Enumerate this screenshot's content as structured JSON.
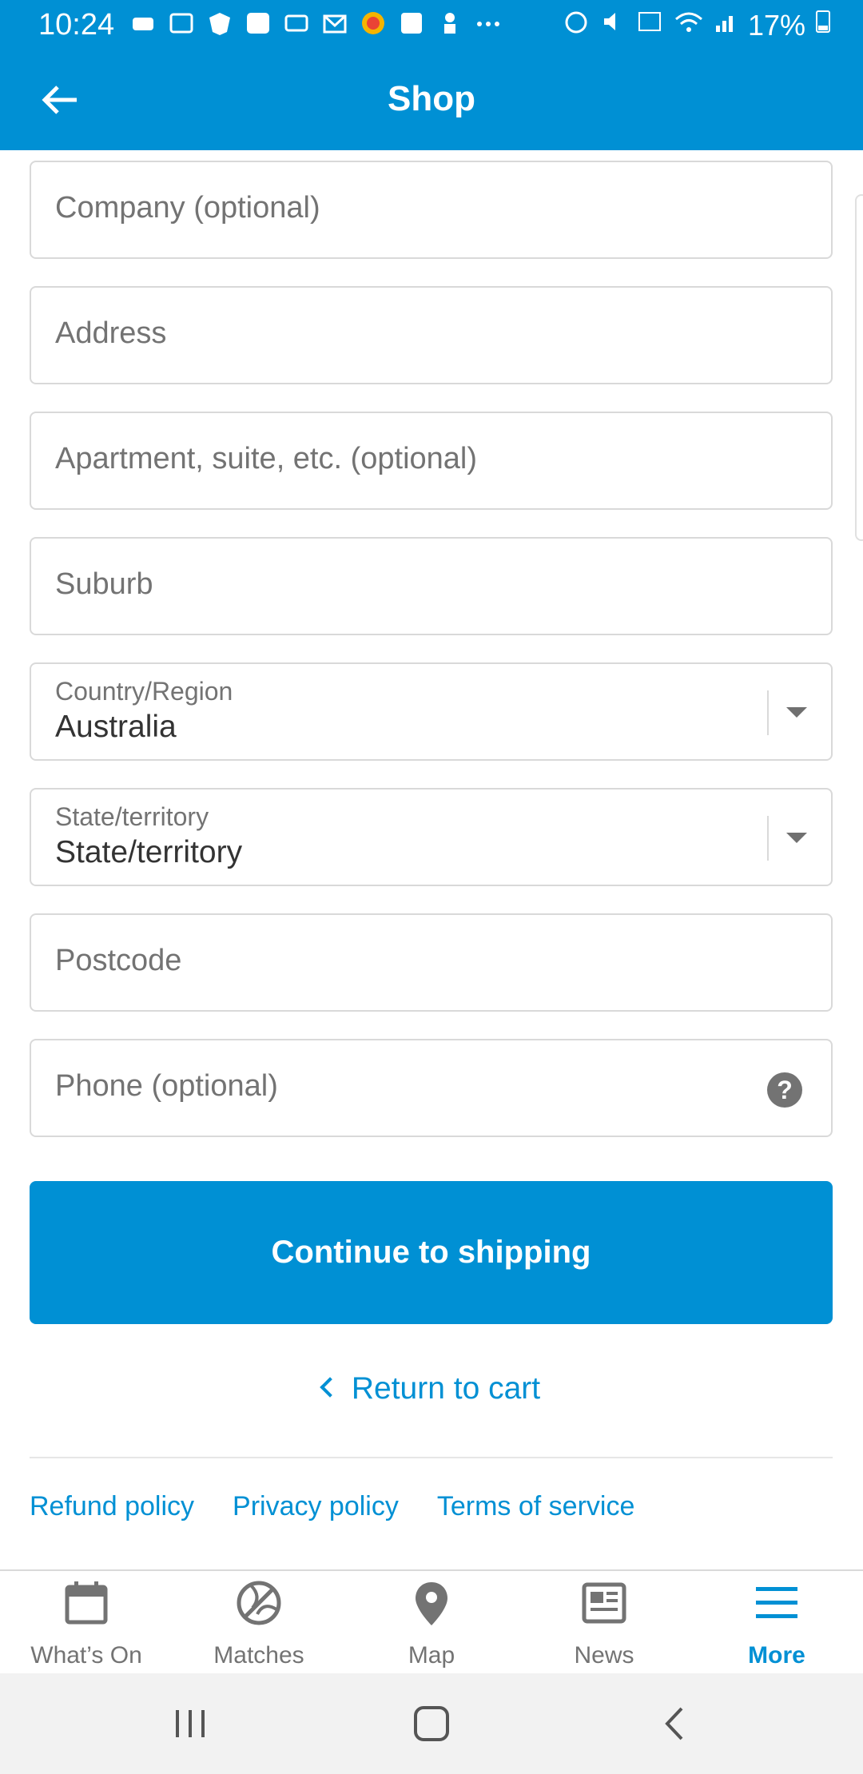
{
  "status_bar": {
    "time": "10:24",
    "battery": "17%"
  },
  "app_bar": {
    "title": "Shop"
  },
  "form": {
    "company_placeholder": "Company (optional)",
    "address_placeholder": "Address",
    "apartment_placeholder": "Apartment, suite, etc. (optional)",
    "suburb_placeholder": "Suburb",
    "country": {
      "label": "Country/Region",
      "value": "Australia"
    },
    "state": {
      "label": "State/territory",
      "value": "State/territory"
    },
    "postcode_placeholder": "Postcode",
    "phone_placeholder": "Phone (optional)",
    "help_symbol": "?"
  },
  "actions": {
    "continue_label": "Continue to shipping",
    "return_label": "Return to cart"
  },
  "footer_links": [
    {
      "label": "Refund policy"
    },
    {
      "label": "Privacy policy"
    },
    {
      "label": "Terms of service"
    }
  ],
  "bottom_nav": [
    {
      "label": "What’s On",
      "icon": "calendar-icon"
    },
    {
      "label": "Matches",
      "icon": "ball-icon"
    },
    {
      "label": "Map",
      "icon": "map-pin-icon"
    },
    {
      "label": "News",
      "icon": "news-icon"
    },
    {
      "label": "More",
      "icon": "menu-icon",
      "active": true
    }
  ],
  "colors": {
    "brand": "#0090d4",
    "inactive": "#737373"
  }
}
